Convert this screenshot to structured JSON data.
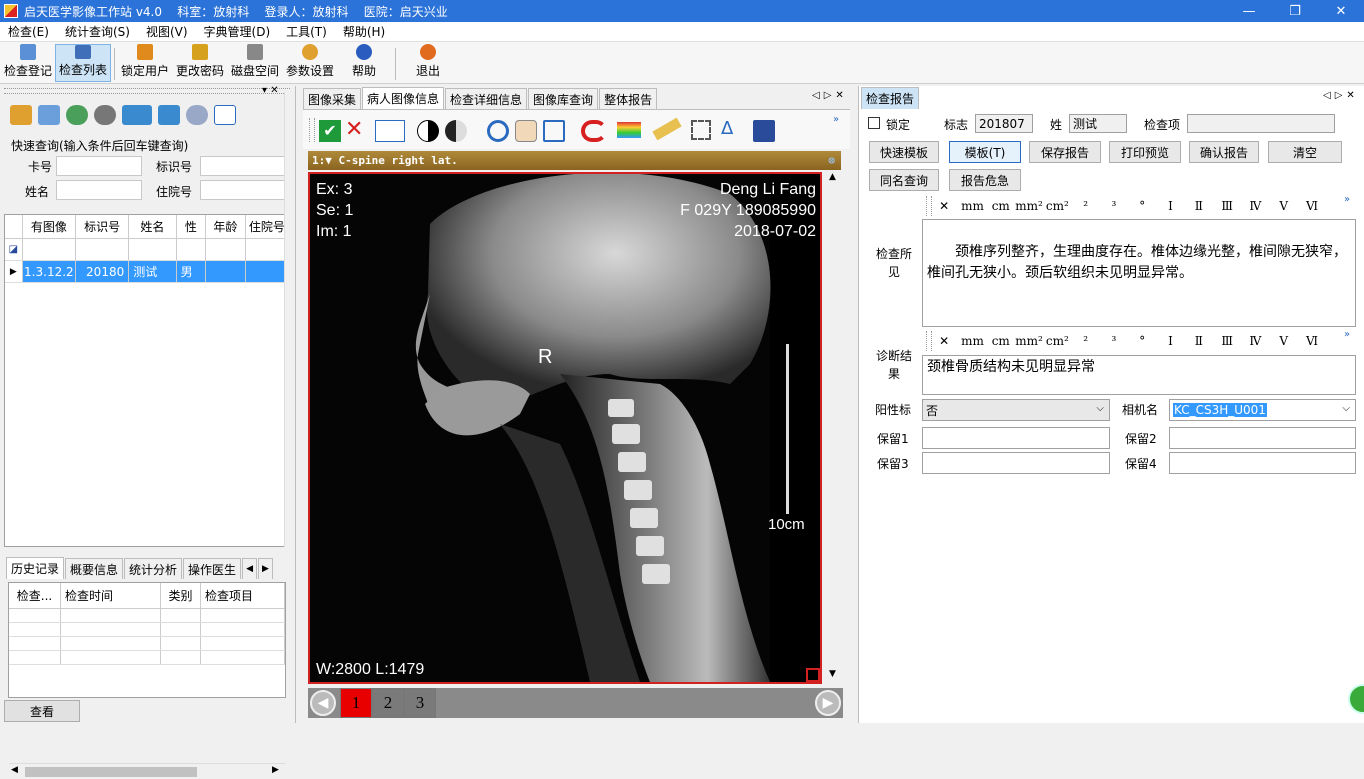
{
  "window": {
    "title": "启天医学影像工作站 v4.0    科室：放射科    登录人：放射科    医院：启天兴业",
    "min": "—",
    "max": "❐",
    "close": "✕"
  },
  "menu": [
    "检查(E)",
    "统计查询(S)",
    "视图(V)",
    "字典管理(D)",
    "工具(T)",
    "帮助(H)"
  ],
  "toolbar": [
    {
      "label": "检查登记",
      "icon": "register-icon",
      "color": "#5b8fd6"
    },
    {
      "label": "检查列表",
      "icon": "list-icon",
      "color": "#3f6fb8"
    },
    {
      "label": "锁定用户",
      "icon": "lock-user-icon",
      "color": "#e08a1e"
    },
    {
      "label": "更改密码",
      "icon": "key-icon",
      "color": "#d6a21e"
    },
    {
      "label": "磁盘空间",
      "icon": "disk-icon",
      "color": "#888888"
    },
    {
      "label": "参数设置",
      "icon": "gear-icon",
      "color": "#e0a030"
    },
    {
      "label": "帮助",
      "icon": "help-icon",
      "color": "#2a5bbf"
    },
    {
      "label": "退出",
      "icon": "exit-icon",
      "color": "#e06a1e"
    }
  ],
  "left": {
    "pin": "▾ ✕",
    "quick_title": "快速查询(输入条件后回车键查询)",
    "labels": {
      "card": "卡号",
      "id": "标识号",
      "name": "姓名",
      "hosp": "住院号"
    },
    "columns": [
      "有图像",
      "标识号",
      "姓名",
      "性",
      "年龄",
      "住院号"
    ],
    "row": {
      "image": "1.3.12.2",
      "id": "20180",
      "name": "测试",
      "sex": "男"
    },
    "tabs": [
      "历史记录",
      "概要信息",
      "统计分析",
      "操作医生"
    ],
    "history_columns": [
      "检查...",
      "检查时间",
      "类别",
      "检查项目"
    ],
    "view_button": "查看"
  },
  "center": {
    "tabs": [
      "图像采集",
      "病人图像信息",
      "检查详细信息",
      "图像库查询",
      "整体报告"
    ],
    "series_title": "1:▼ C-spine right lat.",
    "overlay": {
      "ex": "Ex: 3",
      "se": "Se: 1",
      "im": "Im: 1",
      "patient": "Deng Li Fang",
      "info": "F 029Y 189085990",
      "date": "2018-07-02",
      "marker": "R",
      "scale": "10cm",
      "wl": "W:2800 L:1479"
    },
    "pages": [
      "1",
      "2",
      "3"
    ]
  },
  "right": {
    "tab": "检查报告",
    "lock": "锁定",
    "flag_label": "标志",
    "flag": "201807",
    "surname_label": "姓",
    "surname": "测试",
    "exam_item_label": "检查项",
    "buttons": [
      "快速模板",
      "模板(T)",
      "保存报告",
      "打印预览",
      "确认报告",
      "清空",
      "同名查询",
      "报告危急"
    ],
    "symbols": [
      "✕",
      "mm",
      "cm",
      "mm²",
      "cm²",
      "²",
      "³",
      "°",
      "Ⅰ",
      "Ⅱ",
      "Ⅲ",
      "Ⅳ",
      "Ⅴ",
      "Ⅵ"
    ],
    "findings_label": "检查所见",
    "findings": "　　颈椎序列整齐，生理曲度存在。椎体边缘光整，椎间隙无狭窄，椎间孔无狭小。颈后软组织未见明显异常。",
    "diagnosis_label": "诊断结果",
    "diagnosis": "颈椎骨质结构未见明显异常",
    "positive_label": "阳性标",
    "positive": "否",
    "camera_label": "相机名",
    "camera": "KC_CS3H_U001",
    "reserve": [
      "保留1",
      "保留2",
      "保留3",
      "保留4"
    ]
  }
}
